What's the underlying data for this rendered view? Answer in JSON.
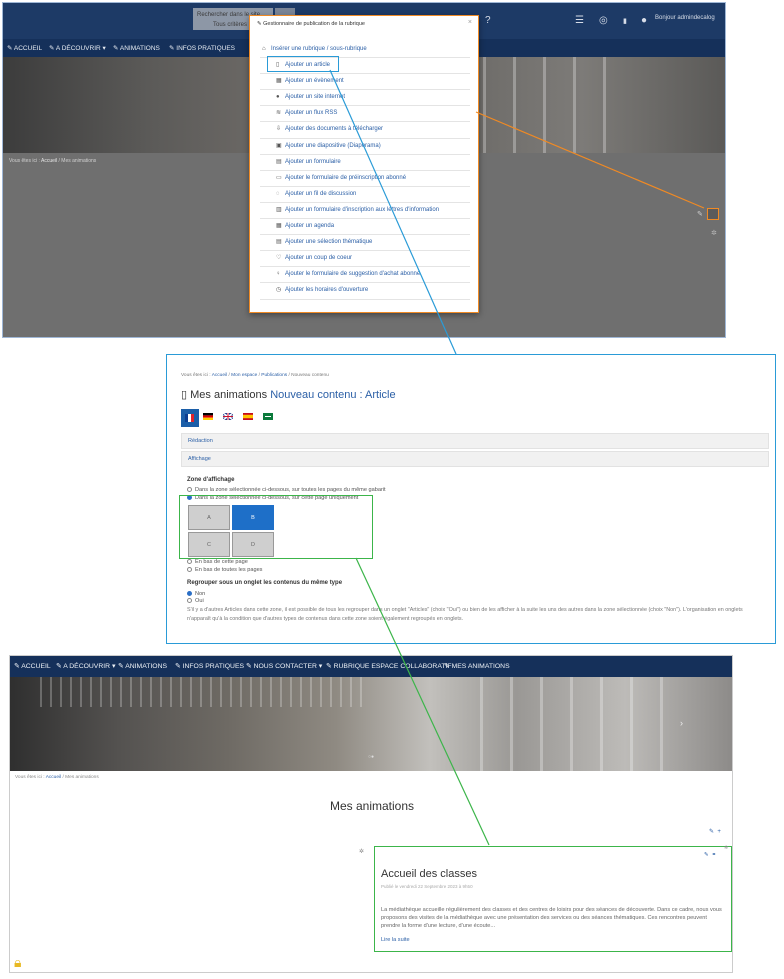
{
  "panel1": {
    "search": {
      "value": "Rechercher dans le site",
      "scope": "Tous critères"
    },
    "user": "Bonjour admindecalog",
    "nav": [
      "ACCUEIL",
      "A DÉCOUVRIR ▾",
      "ANIMATIONS",
      "INFOS PRATIQUES"
    ],
    "breadcrumb": {
      "prefix": "Vous êtes ici :",
      "home": "Accueil",
      "current": "Mes animations"
    },
    "popup": {
      "title": "Gestionnaire de publication de la rubrique",
      "items": [
        {
          "label": "Insérer une rubrique / sous-rubrique",
          "icon": "sitemap-icon"
        },
        {
          "label": "Ajouter un article",
          "icon": "file-icon"
        },
        {
          "label": "Ajouter un évènement",
          "icon": "calendar-icon"
        },
        {
          "label": "Ajouter un site internet",
          "icon": "globe-icon"
        },
        {
          "label": "Ajouter un flux RSS",
          "icon": "rss-icon"
        },
        {
          "label": "Ajouter des documents à télécharger",
          "icon": "download-icon"
        },
        {
          "label": "Ajouter une diapositive (Diaporama)",
          "icon": "image-icon"
        },
        {
          "label": "Ajouter un formulaire",
          "icon": "form-icon"
        },
        {
          "label": "Ajouter le formulaire de préinscription abonné",
          "icon": "id-card-icon"
        },
        {
          "label": "Ajouter un fil de discussion",
          "icon": "comments-icon"
        },
        {
          "label": "Ajouter un formulaire d'inscription aux lettres d'information",
          "icon": "newspaper-icon"
        },
        {
          "label": "Ajouter un agenda",
          "icon": "calendar-icon"
        },
        {
          "label": "Ajouter une sélection thématique",
          "icon": "list-icon"
        },
        {
          "label": "Ajouter un coup de coeur",
          "icon": "heart-icon"
        },
        {
          "label": "Ajouter le formulaire de suggestion d'achat abonné",
          "icon": "lightbulb-icon"
        },
        {
          "label": "Ajouter les horaires d'ouverture",
          "icon": "clock-icon"
        }
      ]
    }
  },
  "panel2": {
    "breadcrumb": {
      "prefix": "Vous êtes ici :",
      "items": [
        "Accueil",
        "Mon espace",
        "Publications"
      ],
      "current": "Nouveau contenu"
    },
    "title_prefix": "Mes animations",
    "title_suffix": "Nouveau contenu : Article",
    "tabs": [
      "Rédaction",
      "Affichage"
    ],
    "zone_title": "Zone d'affichage",
    "zone_options": [
      "Dans la zone sélectionnée ci-dessous, sur toutes les pages du même gabarit",
      "Dans la zone sélectionnée ci-dessous, sur cette page uniquement",
      "En bas de cette page",
      "En bas de toutes les pages"
    ],
    "zones": [
      "A",
      "B",
      "C",
      "D"
    ],
    "selected_zone": "B",
    "group_title": "Regrouper sous un onglet les contenus du même type",
    "group_options": [
      "Non",
      "Oui"
    ],
    "help": "S'il y a d'autres Articles dans cette zone, il est possible de tous les regrouper dans un onglet \"Articles\" (choix \"Oui\") ou bien de les afficher à la suite les uns des autres dans la zone sélectionnée (choix \"Non\"). L'organisation en onglets n'apparaît qu'à la condition que d'autres types de contenus dans cette zone soient également regroupés en onglets."
  },
  "panel3": {
    "nav": [
      "ACCUEIL",
      "A DÉCOUVRIR ▾",
      "ANIMATIONS",
      "INFOS PRATIQUES",
      "NOUS CONTACTER ▾",
      "RUBRIQUE ESPACE COLLABORATIF",
      "MES ANIMATIONS"
    ],
    "breadcrumb": {
      "prefix": "Vous êtes ici :",
      "home": "Accueil",
      "current": "Mes animations"
    },
    "page_title": "Mes animations",
    "article": {
      "title": "Accueil des classes",
      "meta": "Publié le vendredi 22 Septembre 2023 à 9h50",
      "body": "La médiathèque accueille régulièrement des classes et des centres de loisirs pour des séances de découverte. Dans ce cadre, nous vous proposons des visites de la médiathèque avec une présentation des services ou des séances thématiques. Ces rencontres peuvent prendre la forme d'une lecture, d'une écoute...",
      "more": "Lire la suite"
    }
  },
  "colors": {
    "navy": "#15305a",
    "accent_orange": "#f08a24",
    "accent_blue": "#2a9bd7",
    "accent_green": "#3cb54a",
    "link": "#2b5fa6"
  }
}
